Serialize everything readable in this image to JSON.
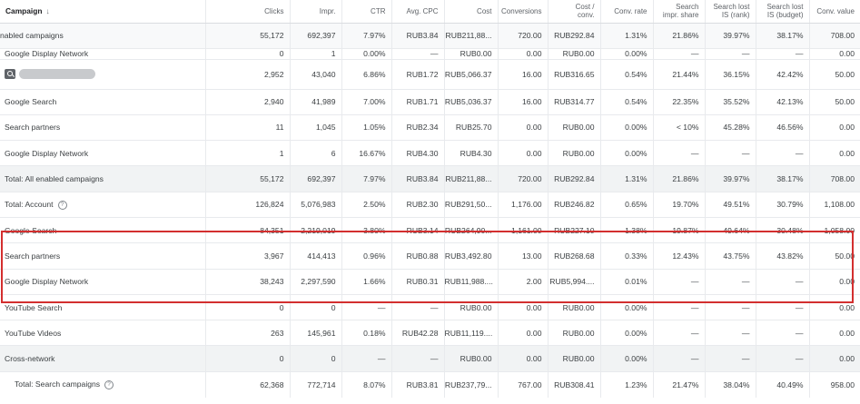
{
  "header": {
    "campaign": "Campaign",
    "sort_arrow": "↓",
    "clicks": "Clicks",
    "impr": "Impr.",
    "ctr": "CTR",
    "avg_cpc": "Avg. CPC",
    "cost": "Cost",
    "conversions": "Conversions",
    "cost_conv_1": "Cost /",
    "cost_conv_2": "conv.",
    "conv_rate": "Conv. rate",
    "search_impr_share_1": "Search",
    "search_impr_share_2": "impr. share",
    "lost_rank_1": "Search lost",
    "lost_rank_2": "IS (rank)",
    "lost_budget_1": "Search lost",
    "lost_budget_2": "IS (budget)",
    "conv_value": "Conv. value"
  },
  "rows": [
    {
      "name": "nabled campaigns",
      "clicks": "55,172",
      "impr": "692,397",
      "ctr": "7.97%",
      "cpc": "RUB3.84",
      "cost": "RUB211,88...",
      "conv": "720.00",
      "cost_conv": "RUB292.84",
      "conv_rate": "1.31%",
      "sis": "21.86%",
      "lost_rank": "39.97%",
      "lost_budget": "38.17%",
      "conv_value": "708.00"
    },
    {
      "name": "Google Display Network",
      "clicks": "0",
      "impr": "1",
      "ctr": "0.00%",
      "cpc": "—",
      "cost": "RUB0.00",
      "conv": "0.00",
      "cost_conv": "RUB0.00",
      "conv_rate": "0.00%",
      "sis": "—",
      "lost_rank": "—",
      "lost_budget": "—",
      "conv_value": "0.00"
    },
    {
      "name": "",
      "clicks": "2,952",
      "impr": "43,040",
      "ctr": "6.86%",
      "cpc": "RUB1.72",
      "cost": "RUB5,066.37",
      "conv": "16.00",
      "cost_conv": "RUB316.65",
      "conv_rate": "0.54%",
      "sis": "21.44%",
      "lost_rank": "36.15%",
      "lost_budget": "42.42%",
      "conv_value": "50.00"
    },
    {
      "name": "Google Search",
      "clicks": "2,940",
      "impr": "41,989",
      "ctr": "7.00%",
      "cpc": "RUB1.71",
      "cost": "RUB5,036.37",
      "conv": "16.00",
      "cost_conv": "RUB314.77",
      "conv_rate": "0.54%",
      "sis": "22.35%",
      "lost_rank": "35.52%",
      "lost_budget": "42.13%",
      "conv_value": "50.00"
    },
    {
      "name": "Search partners",
      "clicks": "11",
      "impr": "1,045",
      "ctr": "1.05%",
      "cpc": "RUB2.34",
      "cost": "RUB25.70",
      "conv": "0.00",
      "cost_conv": "RUB0.00",
      "conv_rate": "0.00%",
      "sis": "< 10%",
      "lost_rank": "45.28%",
      "lost_budget": "46.56%",
      "conv_value": "0.00"
    },
    {
      "name": "Google Display Network",
      "clicks": "1",
      "impr": "6",
      "ctr": "16.67%",
      "cpc": "RUB4.30",
      "cost": "RUB4.30",
      "conv": "0.00",
      "cost_conv": "RUB0.00",
      "conv_rate": "0.00%",
      "sis": "—",
      "lost_rank": "—",
      "lost_budget": "—",
      "conv_value": "0.00"
    },
    {
      "name": "Total: All enabled campaigns",
      "clicks": "55,172",
      "impr": "692,397",
      "ctr": "7.97%",
      "cpc": "RUB3.84",
      "cost": "RUB211,88...",
      "conv": "720.00",
      "cost_conv": "RUB292.84",
      "conv_rate": "1.31%",
      "sis": "21.86%",
      "lost_rank": "39.97%",
      "lost_budget": "38.17%",
      "conv_value": "708.00"
    },
    {
      "name": "Total: Account",
      "clicks": "126,824",
      "impr": "5,076,983",
      "ctr": "2.50%",
      "cpc": "RUB2.30",
      "cost": "RUB291,50...",
      "conv": "1,176.00",
      "cost_conv": "RUB246.82",
      "conv_rate": "0.65%",
      "sis": "19.70%",
      "lost_rank": "49.51%",
      "lost_budget": "30.79%",
      "conv_value": "1,108.00"
    },
    {
      "name": "Google Search",
      "clicks": "84,351",
      "impr": "2,219,019",
      "ctr": "3.80%",
      "cpc": "RUB3.14",
      "cost": "RUB264,90...",
      "conv": "1,161.00",
      "cost_conv": "RUB227.10",
      "conv_rate": "1.38%",
      "sis": "19.87%",
      "lost_rank": "49.64%",
      "lost_budget": "30.48%",
      "conv_value": "1,058.00"
    },
    {
      "name": "Search partners",
      "clicks": "3,967",
      "impr": "414,413",
      "ctr": "0.96%",
      "cpc": "RUB0.88",
      "cost": "RUB3,492.80",
      "conv": "13.00",
      "cost_conv": "RUB268.68",
      "conv_rate": "0.33%",
      "sis": "12.43%",
      "lost_rank": "43.75%",
      "lost_budget": "43.82%",
      "conv_value": "50.00"
    },
    {
      "name": "Google Display Network",
      "clicks": "38,243",
      "impr": "2,297,590",
      "ctr": "1.66%",
      "cpc": "RUB0.31",
      "cost": "RUB11,988....",
      "conv": "2.00",
      "cost_conv": "RUB5,994....",
      "conv_rate": "0.01%",
      "sis": "—",
      "lost_rank": "—",
      "lost_budget": "—",
      "conv_value": "0.00"
    },
    {
      "name": "YouTube Search",
      "clicks": "0",
      "impr": "0",
      "ctr": "—",
      "cpc": "—",
      "cost": "RUB0.00",
      "conv": "0.00",
      "cost_conv": "RUB0.00",
      "conv_rate": "0.00%",
      "sis": "—",
      "lost_rank": "—",
      "lost_budget": "—",
      "conv_value": "0.00"
    },
    {
      "name": "YouTube Videos",
      "clicks": "263",
      "impr": "145,961",
      "ctr": "0.18%",
      "cpc": "RUB42.28",
      "cost": "RUB11,119....",
      "conv": "0.00",
      "cost_conv": "RUB0.00",
      "conv_rate": "0.00%",
      "sis": "—",
      "lost_rank": "—",
      "lost_budget": "—",
      "conv_value": "0.00"
    },
    {
      "name": "Cross-network",
      "clicks": "0",
      "impr": "0",
      "ctr": "—",
      "cpc": "—",
      "cost": "RUB0.00",
      "conv": "0.00",
      "cost_conv": "RUB0.00",
      "conv_rate": "0.00%",
      "sis": "—",
      "lost_rank": "—",
      "lost_budget": "—",
      "conv_value": "0.00"
    },
    {
      "name": "Total: Search campaigns",
      "clicks": "62,368",
      "impr": "772,714",
      "ctr": "8.07%",
      "cpc": "RUB3.81",
      "cost": "RUB237,79...",
      "conv": "767.00",
      "cost_conv": "RUB308.41",
      "conv_rate": "1.23%",
      "sis": "21.47%",
      "lost_rank": "38.04%",
      "lost_budget": "40.49%",
      "conv_value": "958.00"
    }
  ],
  "icons": {
    "search_chip": "search-icon",
    "help": "help-circle-icon",
    "help_glyph": "?"
  },
  "colors": {
    "highlight_border": "#d32f2f"
  }
}
